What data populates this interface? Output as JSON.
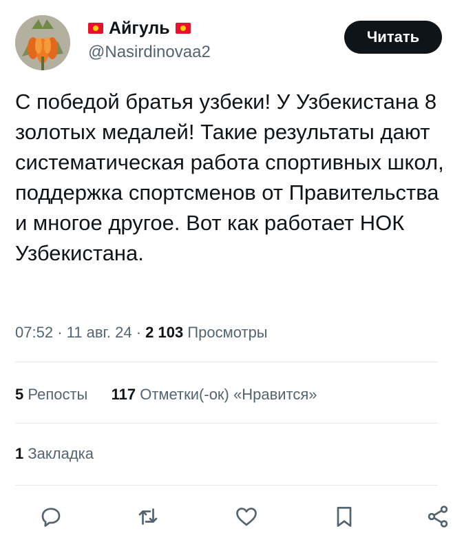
{
  "author": {
    "name": "Айгуль",
    "handle": "@Nasirdinovaa2",
    "avatar_icon": "flower-avatar",
    "flag_icon": "kyrgyzstan-flag"
  },
  "follow_label": "Читать",
  "post": {
    "text": "С победой братья узбеки! У Узбекистана 8 золотых медалей! Такие результаты дают систематическая работа спортивных школ, поддержка спортсменов от Правительства и многое другое. Вот как работает НОК Узбекистана."
  },
  "meta": {
    "time": "07:52",
    "date": "11 авг. 24",
    "separator": "·",
    "views_count": "2 103",
    "views_label": "Просмотры"
  },
  "stats": {
    "reposts_count": "5",
    "reposts_label": "Репосты",
    "likes_count": "117",
    "likes_label": "Отметки(-ок) «Нравится»",
    "bookmarks_count": "1",
    "bookmarks_label": "Закладка"
  },
  "actions": [
    "reply-icon",
    "repost-icon",
    "like-icon",
    "bookmark-icon",
    "share-icon"
  ],
  "colors": {
    "text": "#0f1419",
    "secondary": "#536471",
    "divider": "#e6e9eb",
    "button_bg": "#0f1419",
    "button_text": "#ffffff",
    "flag_red": "#e8112d",
    "flag_sun": "#ffd200"
  }
}
